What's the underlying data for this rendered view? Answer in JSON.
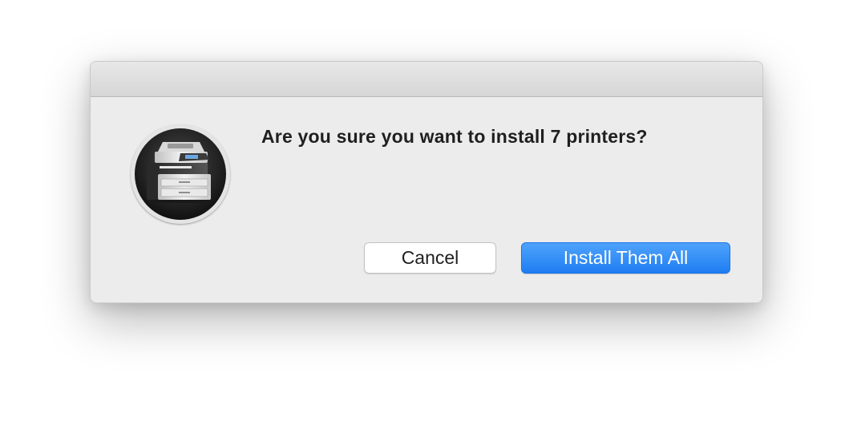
{
  "dialog": {
    "message": "Are you sure you want to install 7 printers?",
    "icon": "printer-icon"
  },
  "buttons": {
    "cancel_label": "Cancel",
    "confirm_label": "Install Them All"
  },
  "colors": {
    "dialog_background": "#ececec",
    "titlebar": "#dedede",
    "primary_button": "#2b86f6",
    "text": "#1f1f1f"
  }
}
